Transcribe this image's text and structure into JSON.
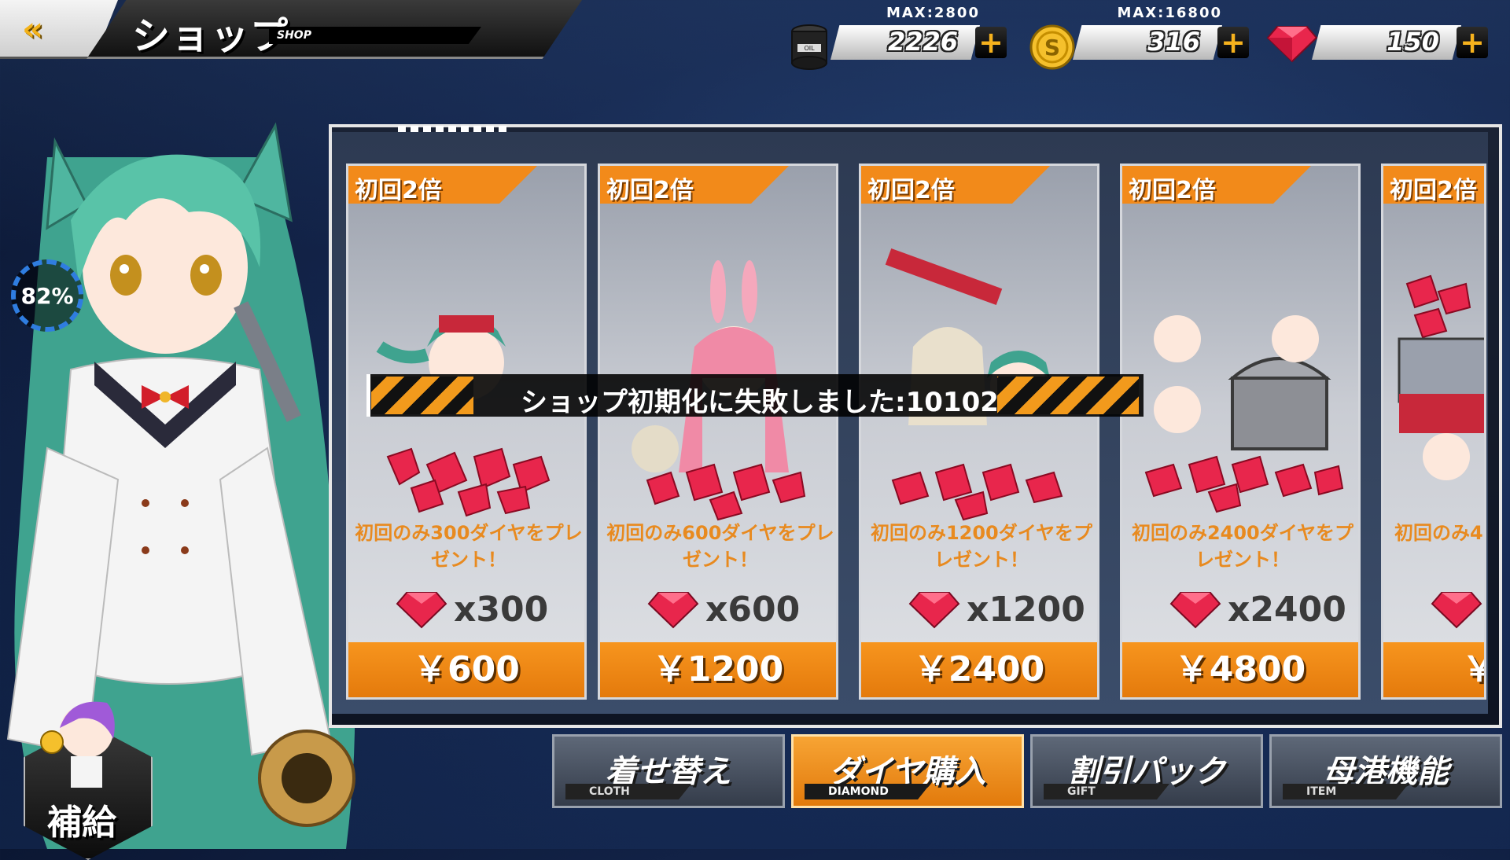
{
  "header": {
    "back_icon": "double-chevron-left-icon",
    "title": "ショップ",
    "subtitle": "SHOP"
  },
  "resources": {
    "oil": {
      "icon": "oil-barrel-icon",
      "max": "MAX:2800",
      "value": "2226"
    },
    "coin": {
      "icon": "coin-icon",
      "max": "MAX:16800",
      "value": "316"
    },
    "diamond": {
      "icon": "ruby-gem-icon",
      "value": "150"
    }
  },
  "character": {
    "sync_percent": "82%"
  },
  "supply": {
    "label": "補給"
  },
  "shop_items": [
    {
      "badge": "初回2倍",
      "desc": "初回のみ300ダイヤをプレゼント！",
      "qty": "x300",
      "price": "￥600"
    },
    {
      "badge": "初回2倍",
      "desc": "初回のみ600ダイヤをプレゼント！",
      "qty": "x600",
      "price": "￥1200"
    },
    {
      "badge": "初回2倍",
      "desc": "初回のみ1200ダイヤをプレゼント！",
      "qty": "x1200",
      "price": "￥2400"
    },
    {
      "badge": "初回2倍",
      "desc": "初回のみ2400ダイヤをプレゼント！",
      "qty": "x2400",
      "price": "￥4800"
    },
    {
      "badge": "初回2倍",
      "desc": "初回のみ4",
      "qty": "",
      "price": "￥"
    }
  ],
  "error_message": "ショップ初期化に失敗しました:10102",
  "tabs": [
    {
      "label": "着せ替え",
      "sub": "CLOTH",
      "active": false
    },
    {
      "label": "ダイヤ購入",
      "sub": "DIAMOND",
      "active": true
    },
    {
      "label": "割引パック",
      "sub": "GIFT",
      "active": false
    },
    {
      "label": "母港機能",
      "sub": "ITEM",
      "active": false
    }
  ],
  "colors": {
    "accent": "#f28a1a",
    "gem": "#e8264c",
    "panel_border": "#e6e6e6"
  }
}
